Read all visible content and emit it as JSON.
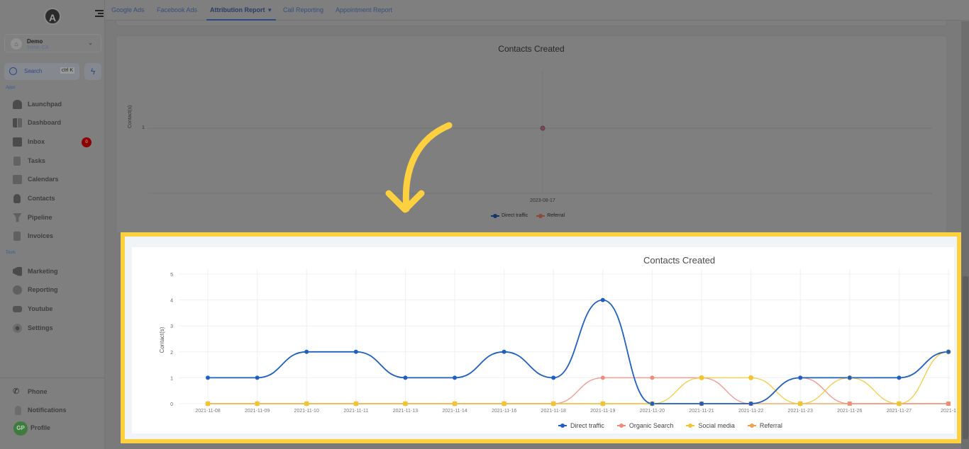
{
  "sidebar": {
    "logo": "A",
    "account": {
      "name": "Demo",
      "location": "Irvine, CA"
    },
    "search": {
      "label": "Search",
      "shortcut": "ctrl K"
    },
    "apps_label": "Apps",
    "tools_label": "Tools",
    "apps": [
      {
        "label": "Launchpad",
        "icon": "rocket-icon"
      },
      {
        "label": "Dashboard",
        "icon": "grid-icon"
      },
      {
        "label": "Inbox",
        "icon": "inbox-icon",
        "badge": "0"
      },
      {
        "label": "Tasks",
        "icon": "clipboard-icon"
      },
      {
        "label": "Calendars",
        "icon": "calendar-icon"
      },
      {
        "label": "Contacts",
        "icon": "person-icon"
      },
      {
        "label": "Pipeline",
        "icon": "funnel-icon"
      },
      {
        "label": "Invoices",
        "icon": "invoice-icon"
      }
    ],
    "tools": [
      {
        "label": "Marketing",
        "icon": "megaphone-icon"
      },
      {
        "label": "Reporting",
        "icon": "pie-chart-icon"
      },
      {
        "label": "Youtube",
        "icon": "youtube-icon"
      },
      {
        "label": "Settings",
        "icon": "gear-icon"
      }
    ],
    "bottom": [
      {
        "label": "Phone",
        "icon": "phone-icon"
      },
      {
        "label": "Notifications",
        "icon": "bell-icon"
      },
      {
        "label": "Profile",
        "initials": "GP"
      }
    ]
  },
  "tabs": [
    {
      "label": "Google Ads"
    },
    {
      "label": "Facebook Ads"
    },
    {
      "label": "Attribution Report",
      "active": true,
      "dropdown": "▾"
    },
    {
      "label": "Call Reporting"
    },
    {
      "label": "Appointment Report"
    }
  ],
  "colors": {
    "highlight": "#fdd03f",
    "direct": "#1f5fbf",
    "organic": "#f08a7a",
    "social": "#f4c430",
    "referral": "#f0a050"
  },
  "chart_data": [
    {
      "type": "line",
      "title": "Contacts Created",
      "xlabel": "",
      "ylabel": "Contact(s)",
      "categories": [
        "2023-08-17"
      ],
      "yticks": [
        "1"
      ],
      "series": [
        {
          "name": "Direct traffic",
          "values": [
            1
          ]
        },
        {
          "name": "Referral",
          "values": [
            1
          ]
        }
      ],
      "legend": "bottom"
    },
    {
      "type": "line",
      "title": "Contacts Created",
      "xlabel": "",
      "ylabel": "Contact(s)",
      "ylim": [
        0,
        5
      ],
      "yticks": [
        "0",
        "1",
        "2",
        "3",
        "4",
        "5"
      ],
      "categories": [
        "2021-11-08",
        "2021-11-09",
        "2021-11-10",
        "2021-11-11",
        "2021-11-13",
        "2021-11-14",
        "2021-11-16",
        "2021-11-18",
        "2021-11-19",
        "2021-11-20",
        "2021-11-21",
        "2021-11-22",
        "2021-11-23",
        "2021-11-26",
        "2021-11-27",
        "2021-1"
      ],
      "series": [
        {
          "name": "Direct traffic",
          "values": [
            1,
            1,
            2,
            2,
            1,
            1,
            2,
            1,
            4,
            0,
            0,
            0,
            1,
            1,
            1,
            2
          ]
        },
        {
          "name": "Organic Search",
          "values": [
            0,
            0,
            0,
            0,
            0,
            0,
            0,
            0,
            1,
            1,
            1,
            0,
            1,
            0,
            0,
            0
          ]
        },
        {
          "name": "Social media",
          "values": [
            0,
            0,
            0,
            0,
            0,
            0,
            0,
            0,
            0,
            0,
            1,
            1,
            0,
            1,
            0,
            2
          ]
        },
        {
          "name": "Referral",
          "values": [
            0,
            0,
            0,
            0,
            0,
            0,
            0,
            0,
            0,
            0,
            0,
            0,
            0,
            0,
            0,
            0
          ]
        }
      ],
      "grid": true,
      "legend": "bottom"
    }
  ]
}
